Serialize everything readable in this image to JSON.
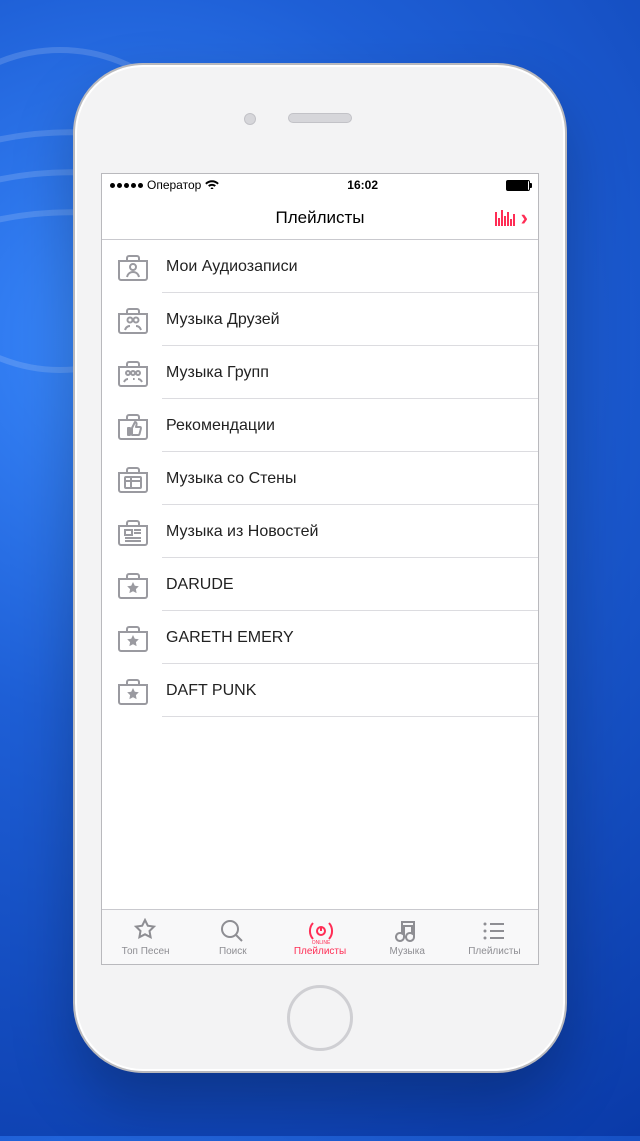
{
  "status": {
    "carrier": "Оператор",
    "time": "16:02"
  },
  "header": {
    "title": "Плейлисты"
  },
  "playlists": [
    {
      "icon": "person",
      "label": "Мои Аудиозаписи"
    },
    {
      "icon": "people",
      "label": "Музыка Друзей"
    },
    {
      "icon": "group",
      "label": "Музыка Групп"
    },
    {
      "icon": "thumb",
      "label": "Рекомендации"
    },
    {
      "icon": "wall",
      "label": "Музыка со Стены"
    },
    {
      "icon": "news",
      "label": "Музыка из Новостей"
    },
    {
      "icon": "star",
      "label": "DARUDE"
    },
    {
      "icon": "star",
      "label": "GARETH EMERY"
    },
    {
      "icon": "star",
      "label": "DAFT PUNK"
    }
  ],
  "tabs": [
    {
      "label": "Топ Песен",
      "icon": "star",
      "active": false
    },
    {
      "label": "Поиск",
      "icon": "search",
      "active": false
    },
    {
      "label": "Плейлисты",
      "icon": "online",
      "active": true
    },
    {
      "label": "Музыка",
      "icon": "note",
      "active": false
    },
    {
      "label": "Плейлисты",
      "icon": "list",
      "active": false
    }
  ],
  "colors": {
    "accent": "#ff2d55",
    "inactive": "#8e8e93"
  }
}
